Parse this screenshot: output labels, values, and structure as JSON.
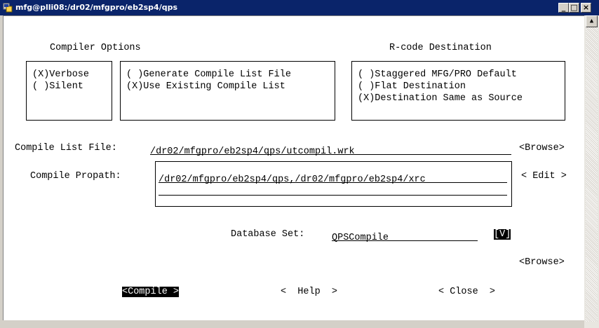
{
  "window": {
    "title": "mfg@plli08:/dr02/mfgpro/eb2sp4/qps",
    "min": "_",
    "max": "□",
    "close": "×"
  },
  "headings": {
    "compiler_options": "Compiler Options",
    "rcode_destination": "R-code Destination"
  },
  "verbosity": {
    "verbose": "(X)Verbose",
    "silent": "( )Silent"
  },
  "compile_list_mode": {
    "generate": "( )Generate Compile List File",
    "use_existing": "(X)Use Existing Compile List"
  },
  "rcode_options": {
    "staggered": "( )Staggered MFG/PRO Default",
    "flat": "( )Flat Destination",
    "same_as_source": "(X)Destination Same as Source"
  },
  "compile_list_file": {
    "label": "Compile List File:",
    "value": "/dr02/mfgpro/eb2sp4/qps/utcompil.wrk",
    "browse": "<Browse>"
  },
  "compile_propath": {
    "label": "Compile Propath:",
    "line1": "/dr02/mfgpro/eb2sp4/qps,/dr02/mfgpro/eb2sp4/xrc",
    "line2": "",
    "edit": "< Edit >"
  },
  "database_set": {
    "label": "Database Set:",
    "value": "QPSCompile",
    "toggle": "[V]"
  },
  "browse2": "<Browse>",
  "buttons": {
    "compile": "<Compile >",
    "help": "<  Help  >",
    "close": "< Close  >"
  }
}
